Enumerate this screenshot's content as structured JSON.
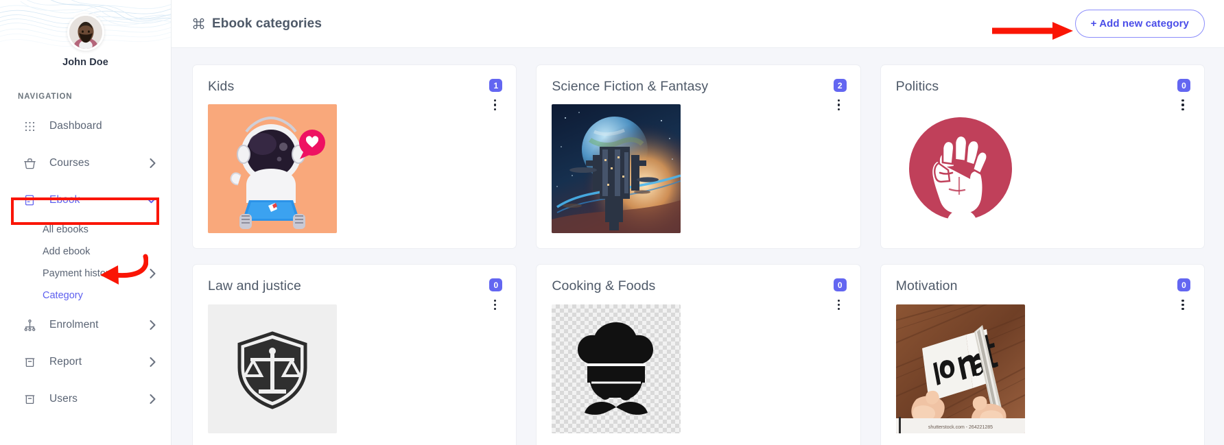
{
  "sidebar": {
    "profile": {
      "name": "John Doe",
      "avatar_icon": "user-avatar"
    },
    "section_title": "NAVIGATION",
    "items": [
      {
        "label": "Dashboard",
        "icon": "grid-dots-icon",
        "has_caret": false,
        "active": false
      },
      {
        "label": "Courses",
        "icon": "basket-icon",
        "has_caret": true,
        "active": false
      },
      {
        "label": "Ebook",
        "icon": "book-document-icon",
        "has_caret": true,
        "active": true,
        "expanded": true
      },
      {
        "label": "Enrolment",
        "icon": "hierarchy-icon",
        "has_caret": true,
        "active": false
      },
      {
        "label": "Report",
        "icon": "archive-box-icon",
        "has_caret": true,
        "active": false
      },
      {
        "label": "Users",
        "icon": "archive-box-icon",
        "has_caret": true,
        "active": false
      }
    ],
    "ebook_submenu": [
      {
        "label": "All ebooks",
        "has_caret": false,
        "active": false
      },
      {
        "label": "Add ebook",
        "has_caret": false,
        "active": false
      },
      {
        "label": "Payment history",
        "has_caret": true,
        "active": false
      },
      {
        "label": "Category",
        "has_caret": false,
        "active": true
      }
    ]
  },
  "header": {
    "title": "Ebook categories",
    "title_icon": "command-grid-icon",
    "add_button_label": "+ Add new category"
  },
  "annotations": {
    "color": "#fa1505",
    "ebook_highlight_box": true,
    "arrow_to_category": true,
    "arrow_to_add_button": true
  },
  "colors": {
    "accent": "#5d5fef",
    "badge": "#6366f1",
    "annotation_red": "#fa1505",
    "text": "#4e5968",
    "page_bg": "#f5f6fa"
  },
  "categories": [
    {
      "title": "Kids",
      "count": "1",
      "image": "astronaut-with-laptop-illustration",
      "bg": "#f9a87b"
    },
    {
      "title": "Science Fiction & Fantasy",
      "count": "2",
      "image": "space-station-planet-artwork",
      "bg": "#121c33"
    },
    {
      "title": "Politics",
      "count": "0",
      "image": "raised-fist-circle-icon",
      "bg": "#ffffff"
    },
    {
      "title": "Law and justice",
      "count": "0",
      "image": "scales-of-justice-shield-icon",
      "bg": "#efefef"
    },
    {
      "title": "Cooking & Foods",
      "count": "0",
      "image": "chef-hat-mustache-icon",
      "bg": "transparent-checkerboard"
    },
    {
      "title": "Motivation",
      "count": "0",
      "image": "i-cant-cut-to-i-can-photo",
      "bg": "#8b5a38",
      "watermark": "shutterstock.com - 264221285"
    }
  ]
}
